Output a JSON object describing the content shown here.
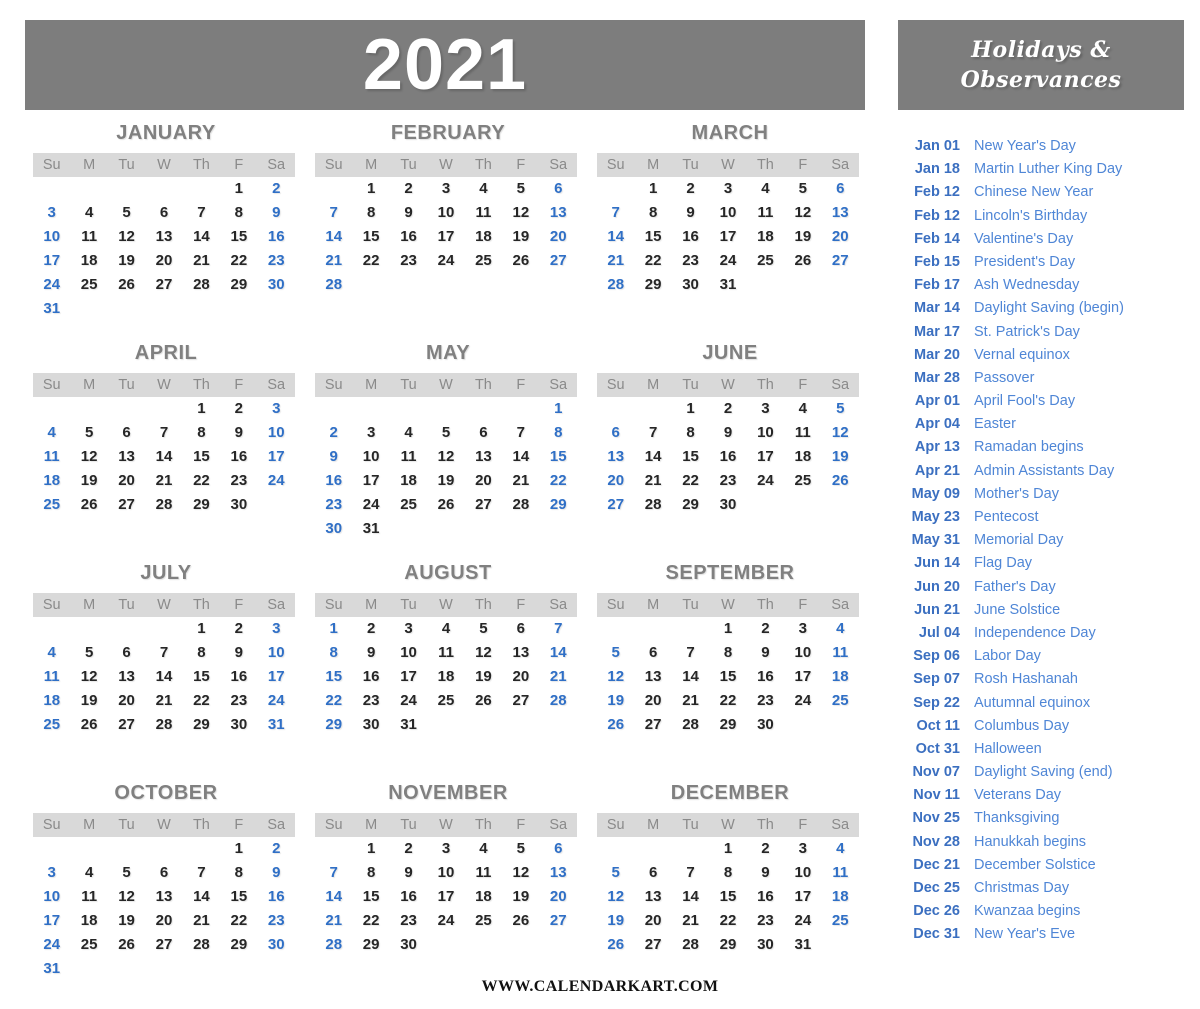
{
  "year_title": "2021",
  "colors": {
    "header_bar": "#7d7d7d",
    "weekday_strip": "#d9d9d9",
    "weekday_text": "#8a8a8a",
    "month_title": "#808080",
    "weekday_number": "#262626",
    "weekend_number": "#2f6fc6",
    "holiday_date": "#3b6fc0",
    "holiday_name": "#4f86d6",
    "page_background": "#ffffff"
  },
  "weekday_headers": [
    "Su",
    "M",
    "Tu",
    "W",
    "Th",
    "F",
    "Sa"
  ],
  "months": [
    {
      "name": "JANUARY",
      "lead_blanks": 5,
      "days": 31,
      "weekend_days": [
        2,
        3,
        9,
        10,
        16,
        17,
        23,
        24,
        30,
        31
      ],
      "holiday_days": [
        1,
        18
      ]
    },
    {
      "name": "FEBRUARY",
      "lead_blanks": 1,
      "days": 28,
      "weekend_days": [
        6,
        7,
        13,
        14,
        20,
        21,
        27,
        28
      ],
      "holiday_days": [
        12,
        15,
        17
      ]
    },
    {
      "name": "MARCH",
      "lead_blanks": 1,
      "days": 31,
      "weekend_days": [
        6,
        7,
        13,
        14,
        20,
        21,
        27,
        28
      ],
      "holiday_days": [
        14,
        17,
        20,
        28
      ]
    },
    {
      "name": "APRIL",
      "lead_blanks": 4,
      "days": 30,
      "weekend_days": [
        3,
        4,
        10,
        11,
        17,
        18,
        24,
        25
      ],
      "holiday_days": [
        1,
        4,
        13,
        21
      ]
    },
    {
      "name": "MAY",
      "lead_blanks": 6,
      "days": 31,
      "weekend_days": [
        1,
        2,
        8,
        9,
        15,
        16,
        22,
        23,
        29,
        30
      ],
      "holiday_days": [
        9,
        23,
        31
      ]
    },
    {
      "name": "JUNE",
      "lead_blanks": 2,
      "days": 30,
      "weekend_days": [
        5,
        6,
        12,
        13,
        19,
        20,
        26,
        27
      ],
      "holiday_days": [
        14,
        20,
        21
      ]
    },
    {
      "name": "JULY",
      "lead_blanks": 4,
      "days": 31,
      "weekend_days": [
        3,
        4,
        10,
        11,
        17,
        18,
        24,
        25,
        31
      ],
      "holiday_days": [
        4
      ]
    },
    {
      "name": "AUGUST",
      "lead_blanks": 0,
      "days": 31,
      "weekend_days": [
        1,
        7,
        8,
        14,
        15,
        21,
        22,
        28,
        29
      ],
      "holiday_days": []
    },
    {
      "name": "SEPTEMBER",
      "lead_blanks": 3,
      "days": 30,
      "weekend_days": [
        4,
        5,
        11,
        12,
        18,
        19,
        25,
        26
      ],
      "holiday_days": [
        6,
        7,
        22
      ]
    },
    {
      "name": "OCTOBER",
      "lead_blanks": 5,
      "days": 31,
      "weekend_days": [
        2,
        3,
        9,
        10,
        16,
        17,
        23,
        24,
        30,
        31
      ],
      "holiday_days": [
        11,
        31
      ]
    },
    {
      "name": "NOVEMBER",
      "lead_blanks": 1,
      "days": 30,
      "weekend_days": [
        6,
        7,
        13,
        14,
        20,
        21,
        27,
        28
      ],
      "holiday_days": [
        7,
        11,
        25,
        28
      ]
    },
    {
      "name": "DECEMBER",
      "lead_blanks": 3,
      "days": 31,
      "weekend_days": [
        4,
        5,
        11,
        12,
        18,
        19,
        25,
        26
      ],
      "holiday_days": [
        21,
        25,
        26,
        31
      ]
    }
  ],
  "holidays_panel": {
    "title_line1": "Holidays &",
    "title_line2": "Observances",
    "items": [
      {
        "date": "Jan 01",
        "name": "New Year's Day"
      },
      {
        "date": "Jan 18",
        "name": "Martin Luther King Day"
      },
      {
        "date": "Feb 12",
        "name": "Chinese New Year"
      },
      {
        "date": "Feb 12",
        "name": "Lincoln's Birthday"
      },
      {
        "date": "Feb 14",
        "name": "Valentine's Day"
      },
      {
        "date": "Feb 15",
        "name": "President's Day"
      },
      {
        "date": "Feb 17",
        "name": "Ash Wednesday"
      },
      {
        "date": "Mar 14",
        "name": "Daylight Saving (begin)"
      },
      {
        "date": "Mar 17",
        "name": "St. Patrick's Day"
      },
      {
        "date": "Mar 20",
        "name": "Vernal equinox"
      },
      {
        "date": "Mar 28",
        "name": "Passover"
      },
      {
        "date": "Apr 01",
        "name": "April Fool's Day"
      },
      {
        "date": "Apr 04",
        "name": "Easter"
      },
      {
        "date": "Apr 13",
        "name": "Ramadan begins"
      },
      {
        "date": "Apr 21",
        "name": "Admin Assistants Day"
      },
      {
        "date": "May 09",
        "name": "Mother's Day"
      },
      {
        "date": "May 23",
        "name": "Pentecost"
      },
      {
        "date": "May 31",
        "name": "Memorial Day"
      },
      {
        "date": "Jun 14",
        "name": "Flag Day"
      },
      {
        "date": "Jun 20",
        "name": "Father's Day"
      },
      {
        "date": "Jun 21",
        "name": "June Solstice"
      },
      {
        "date": "Jul 04",
        "name": "Independence Day"
      },
      {
        "date": "Sep 06",
        "name": "Labor Day"
      },
      {
        "date": "Sep 07",
        "name": "Rosh Hashanah"
      },
      {
        "date": "Sep 22",
        "name": "Autumnal equinox"
      },
      {
        "date": "Oct 11",
        "name": "Columbus Day"
      },
      {
        "date": "Oct 31",
        "name": "Halloween"
      },
      {
        "date": "Nov 07",
        "name": "Daylight Saving (end)"
      },
      {
        "date": "Nov 11",
        "name": "Veterans Day"
      },
      {
        "date": "Nov 25",
        "name": "Thanksgiving"
      },
      {
        "date": "Nov 28",
        "name": "Hanukkah begins"
      },
      {
        "date": "Dec 21",
        "name": "December Solstice"
      },
      {
        "date": "Dec 25",
        "name": "Christmas Day"
      },
      {
        "date": "Dec 26",
        "name": "Kwanzaa begins"
      },
      {
        "date": "Dec 31",
        "name": "New Year's Eve"
      }
    ]
  },
  "footer": {
    "text": "WWW.CALENDARKART.COM"
  }
}
